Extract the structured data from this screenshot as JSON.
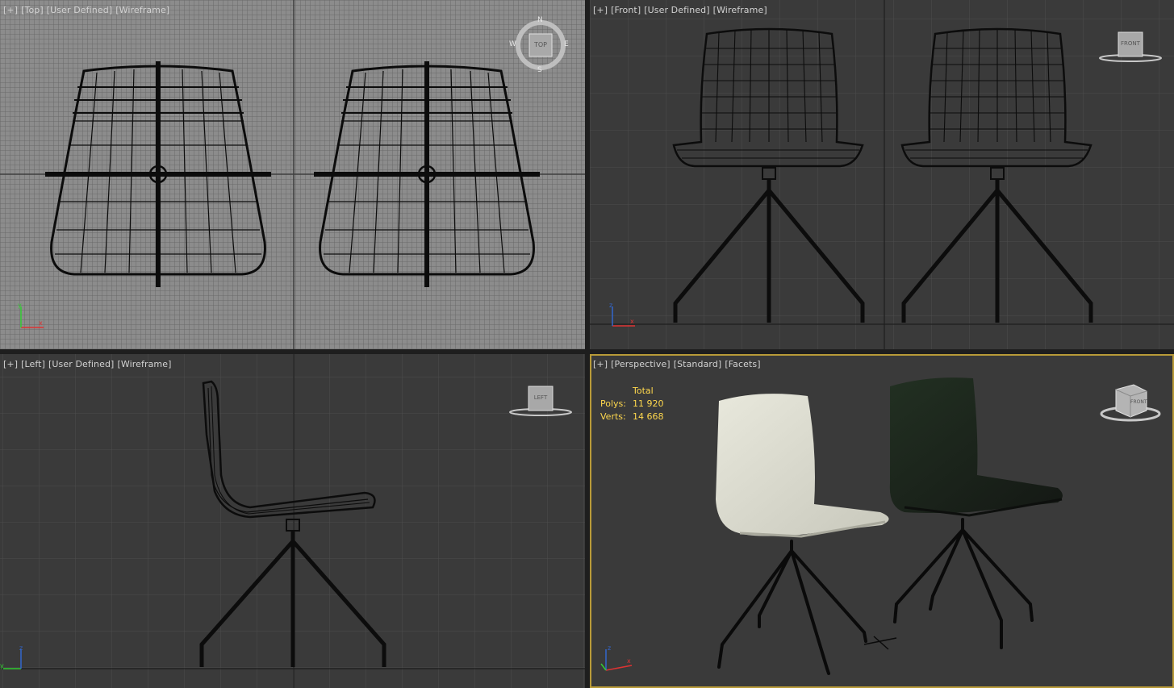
{
  "viewports": {
    "top": {
      "labels": [
        "[+]",
        "[Top]",
        "[User Defined]",
        "[Wireframe]"
      ],
      "viewcube": {
        "face": "TOP",
        "north": "N",
        "south": "S",
        "east": "E",
        "west": "W"
      },
      "axis": {
        "x": "x",
        "y": "y"
      }
    },
    "front": {
      "labels": [
        "[+]",
        "[Front]",
        "[User Defined]",
        "[Wireframe]"
      ],
      "viewcube": {
        "face": "FRONT"
      },
      "axis": {
        "x": "x",
        "y": "z"
      }
    },
    "left": {
      "labels": [
        "[+]",
        "[Left]",
        "[User Defined]",
        "[Wireframe]"
      ],
      "viewcube": {
        "face": "LEFT"
      },
      "axis": {
        "x": "y",
        "y": "z"
      }
    },
    "perspective": {
      "labels": [
        "[+]",
        "[Perspective]",
        "[Standard]",
        "[Facets]"
      ],
      "viewcube": {
        "face": "FRONT"
      },
      "stats": {
        "header": "Total",
        "polys_label": "Polys:",
        "polys": "11 920",
        "verts_label": "Verts:",
        "verts": "14 668"
      },
      "axis": {
        "x": "x",
        "y": "z"
      }
    }
  },
  "colors": {
    "bg": "#3a3a3a",
    "grid": "#4a4a4a",
    "active_border": "#b89a38",
    "stats_text": "#ffd84d",
    "chair_white": "#dcdcd0",
    "chair_dark": "#1d231d"
  }
}
